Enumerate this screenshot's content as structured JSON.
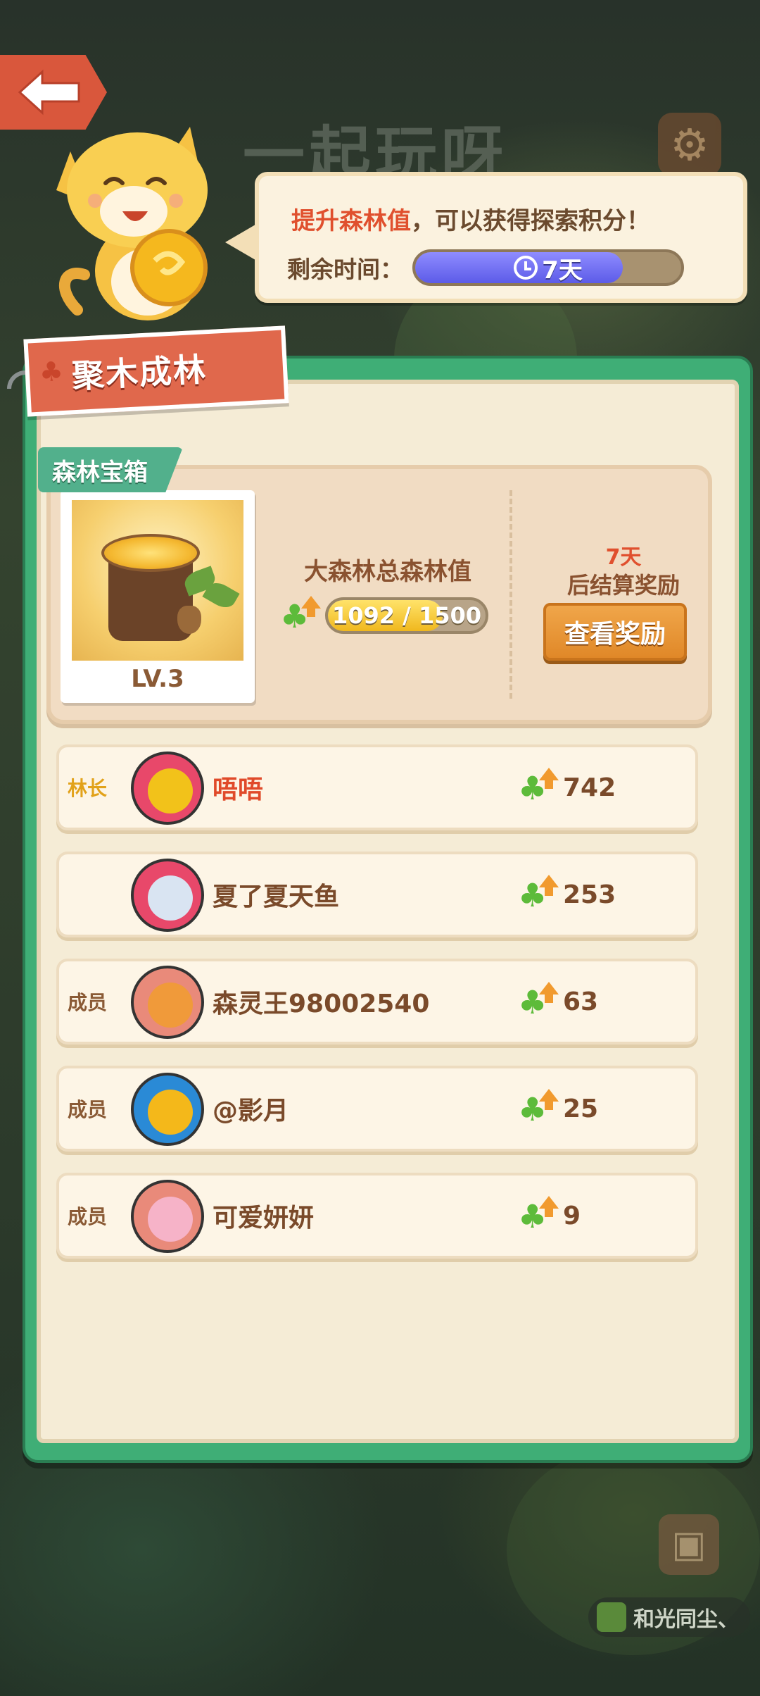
{
  "background": {
    "title": "一起玩呀"
  },
  "header": {
    "back_icon": "back-arrow-icon",
    "settings_icon": "gear-icon"
  },
  "bubble": {
    "prefix": "提升森林值",
    "suffix": "，可以获得探索积分！",
    "time_label": "剩余时间：",
    "time_value": "7天",
    "time_progress": 0.78
  },
  "panel": {
    "title": "聚木成林",
    "chest_tag": "森林宝箱",
    "chest_level": "LV.3",
    "forest_value_label": "大森林总森林值",
    "forest_value_text": "1092 / 1500",
    "forest_progress": 0.728,
    "settle_days": "7天",
    "settle_text": "后结算奖励",
    "reward_button": "查看奖励"
  },
  "members": [
    {
      "role": "林长",
      "name": "唔唔",
      "score": "742",
      "avatar_color": "#f2c21a"
    },
    {
      "role": "",
      "name": "夏了夏天鱼",
      "score": "253",
      "avatar_color": "#d9e4f2"
    },
    {
      "role": "成员",
      "name": "森灵王98002540",
      "score": "63",
      "avatar_color": "#f09a3a"
    },
    {
      "role": "成员",
      "name": "@影月",
      "score": "25",
      "avatar_color": "#f4b81a"
    },
    {
      "role": "成员",
      "name": "可爱妍妍",
      "score": "9",
      "avatar_color": "#f6b3c8"
    }
  ],
  "footer": {
    "user_icon": "profile-card-icon",
    "tag_text": "和光同尘、"
  },
  "colors": {
    "panel_green": "#3fae76",
    "accent_red": "#e0502e",
    "button_orange": "#e08828"
  }
}
